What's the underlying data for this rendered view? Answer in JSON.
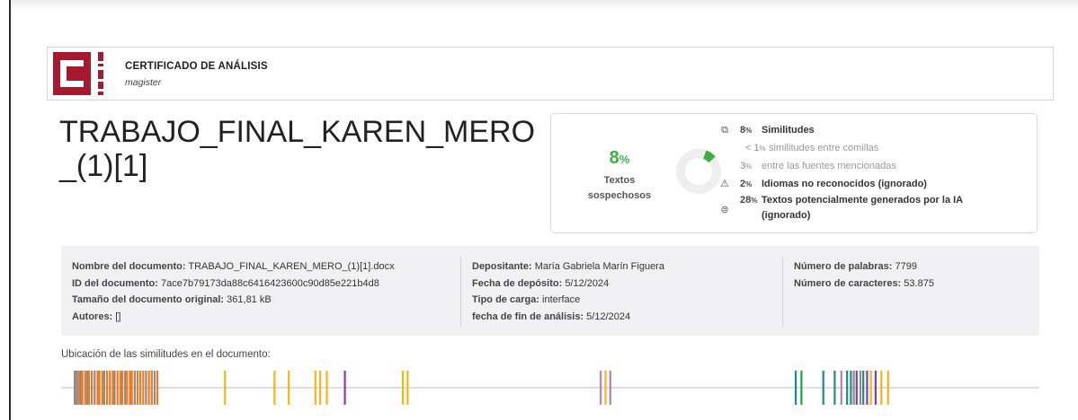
{
  "header": {
    "title": "CERTIFICADO DE ANÁLISIS",
    "subtitle": "magister",
    "logo_letters": "C  .net"
  },
  "document_title": "TRABAJO_FINAL_KAREN_MERO_(1)[1]",
  "summary": {
    "percent_value": "8",
    "percent_unit": "%",
    "percent_fraction": 0.08,
    "label": "Textos sospechosos"
  },
  "stats": [
    {
      "icon": "copy-icon",
      "value": "8",
      "unit": "%",
      "text": "Similitudes",
      "style": "main"
    },
    {
      "icon": "",
      "value": "< 1",
      "unit": "%",
      "text": "similitudes entre comillas",
      "style": "sub"
    },
    {
      "icon": "",
      "value": "3",
      "unit": "%",
      "text": "entre las fuentes mencionadas",
      "style": "sub2"
    },
    {
      "icon": "language-warning-icon",
      "value": "2",
      "unit": "%",
      "text": "Idiomas no reconocidos (ignorado)",
      "style": "main"
    },
    {
      "icon": "ai-icon",
      "value": "28",
      "unit": "%",
      "text": "Textos potencialmente generados por la IA (ignorado)",
      "style": "tall"
    }
  ],
  "metadata": {
    "col1": [
      {
        "key": "Nombre del documento:",
        "value": "TRABAJO_FINAL_KAREN_MERO_(1)[1].docx"
      },
      {
        "key": "ID del documento:",
        "value": "7ace7b79173da88c6416423600c90d85e221b4d8"
      },
      {
        "key": "Tamaño del documento original:",
        "value": "361,81 kB"
      },
      {
        "key": "Autores:",
        "value": "[]"
      }
    ],
    "col2": [
      {
        "key": "Depositante:",
        "value": "María Gabriela Marín Figuera"
      },
      {
        "key": "Fecha de depósito:",
        "value": "5/12/2024"
      },
      {
        "key": "Tipo de carga:",
        "value": "interface"
      },
      {
        "key": "fecha de fin de análisis:",
        "value": "5/12/2024"
      }
    ],
    "col3": [
      {
        "key": "Número de palabras:",
        "value": "7799"
      },
      {
        "key": "Número de caracteres:",
        "value": "53.875"
      }
    ]
  },
  "locations": {
    "title": "Ubicación de las similitudes en el documento:",
    "colors": {
      "gray": "#8c8c8c",
      "orange": "#f07a23",
      "yellow": "#f2b51b",
      "purple": "#8e3b9b",
      "green": "#2e9b3a",
      "teal": "#1f8a8a",
      "lavender": "#b27fc0"
    },
    "marks": [
      {
        "pos": 0.0,
        "color": "gray"
      },
      {
        "pos": 0.002,
        "color": "gray"
      },
      {
        "pos": 0.004,
        "color": "orange"
      },
      {
        "pos": 0.006,
        "color": "gray"
      },
      {
        "pos": 0.008,
        "color": "orange"
      },
      {
        "pos": 0.011,
        "color": "orange"
      },
      {
        "pos": 0.013,
        "color": "gray"
      },
      {
        "pos": 0.015,
        "color": "orange"
      },
      {
        "pos": 0.018,
        "color": "orange"
      },
      {
        "pos": 0.021,
        "color": "gray"
      },
      {
        "pos": 0.024,
        "color": "orange"
      },
      {
        "pos": 0.026,
        "color": "orange"
      },
      {
        "pos": 0.029,
        "color": "orange"
      },
      {
        "pos": 0.031,
        "color": "gray"
      },
      {
        "pos": 0.034,
        "color": "orange"
      },
      {
        "pos": 0.037,
        "color": "orange"
      },
      {
        "pos": 0.04,
        "color": "orange"
      },
      {
        "pos": 0.042,
        "color": "gray"
      },
      {
        "pos": 0.045,
        "color": "orange"
      },
      {
        "pos": 0.048,
        "color": "orange"
      },
      {
        "pos": 0.05,
        "color": "orange"
      },
      {
        "pos": 0.053,
        "color": "gray"
      },
      {
        "pos": 0.055,
        "color": "orange"
      },
      {
        "pos": 0.058,
        "color": "orange"
      },
      {
        "pos": 0.06,
        "color": "orange"
      },
      {
        "pos": 0.063,
        "color": "gray"
      },
      {
        "pos": 0.066,
        "color": "orange"
      },
      {
        "pos": 0.069,
        "color": "orange"
      },
      {
        "pos": 0.072,
        "color": "orange"
      },
      {
        "pos": 0.075,
        "color": "gray"
      },
      {
        "pos": 0.078,
        "color": "orange"
      },
      {
        "pos": 0.081,
        "color": "orange"
      },
      {
        "pos": 0.084,
        "color": "gray"
      },
      {
        "pos": 0.087,
        "color": "orange"
      },
      {
        "pos": 0.158,
        "color": "yellow"
      },
      {
        "pos": 0.21,
        "color": "yellow"
      },
      {
        "pos": 0.225,
        "color": "yellow"
      },
      {
        "pos": 0.253,
        "color": "yellow"
      },
      {
        "pos": 0.258,
        "color": "yellow"
      },
      {
        "pos": 0.265,
        "color": "yellow"
      },
      {
        "pos": 0.284,
        "color": "purple"
      },
      {
        "pos": 0.345,
        "color": "yellow"
      },
      {
        "pos": 0.35,
        "color": "yellow"
      },
      {
        "pos": 0.553,
        "color": "lavender"
      },
      {
        "pos": 0.558,
        "color": "yellow"
      },
      {
        "pos": 0.563,
        "color": "lavender"
      },
      {
        "pos": 0.758,
        "color": "teal"
      },
      {
        "pos": 0.764,
        "color": "green"
      },
      {
        "pos": 0.787,
        "color": "teal"
      },
      {
        "pos": 0.799,
        "color": "teal"
      },
      {
        "pos": 0.806,
        "color": "lavender"
      },
      {
        "pos": 0.812,
        "color": "teal"
      },
      {
        "pos": 0.816,
        "color": "teal"
      },
      {
        "pos": 0.819,
        "color": "gray"
      },
      {
        "pos": 0.822,
        "color": "purple"
      },
      {
        "pos": 0.826,
        "color": "gray"
      },
      {
        "pos": 0.829,
        "color": "teal"
      },
      {
        "pos": 0.833,
        "color": "purple"
      },
      {
        "pos": 0.837,
        "color": "yellow"
      },
      {
        "pos": 0.842,
        "color": "purple"
      },
      {
        "pos": 0.848,
        "color": "yellow"
      },
      {
        "pos": 0.855,
        "color": "yellow"
      }
    ]
  }
}
